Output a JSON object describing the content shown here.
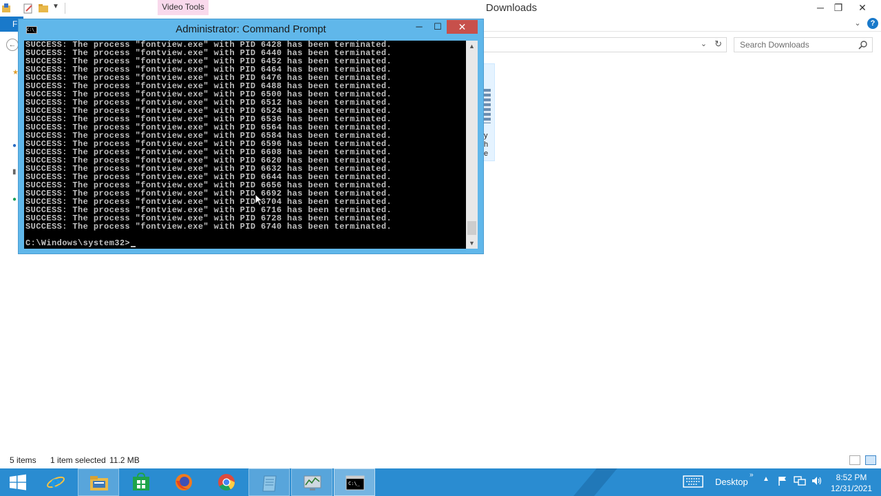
{
  "explorer": {
    "title": "Downloads",
    "contextual_tab": "Video Tools",
    "file_tab": "F",
    "search_placeholder": "Search Downloads",
    "tile_text": [
      "y",
      "h",
      "e"
    ],
    "status": {
      "items": "5 items",
      "selected": "1 item selected",
      "size": "11.2 MB"
    }
  },
  "cmd": {
    "title": "Administrator: Command Prompt",
    "icon_text": "C:\\_",
    "lines": [
      "SUCCESS: The process \"fontview.exe\" with PID 6428 has been terminated.",
      "SUCCESS: The process \"fontview.exe\" with PID 6440 has been terminated.",
      "SUCCESS: The process \"fontview.exe\" with PID 6452 has been terminated.",
      "SUCCESS: The process \"fontview.exe\" with PID 6464 has been terminated.",
      "SUCCESS: The process \"fontview.exe\" with PID 6476 has been terminated.",
      "SUCCESS: The process \"fontview.exe\" with PID 6488 has been terminated.",
      "SUCCESS: The process \"fontview.exe\" with PID 6500 has been terminated.",
      "SUCCESS: The process \"fontview.exe\" with PID 6512 has been terminated.",
      "SUCCESS: The process \"fontview.exe\" with PID 6524 has been terminated.",
      "SUCCESS: The process \"fontview.exe\" with PID 6536 has been terminated.",
      "SUCCESS: The process \"fontview.exe\" with PID 6564 has been terminated.",
      "SUCCESS: The process \"fontview.exe\" with PID 6584 has been terminated.",
      "SUCCESS: The process \"fontview.exe\" with PID 6596 has been terminated.",
      "SUCCESS: The process \"fontview.exe\" with PID 6608 has been terminated.",
      "SUCCESS: The process \"fontview.exe\" with PID 6620 has been terminated.",
      "SUCCESS: The process \"fontview.exe\" with PID 6632 has been terminated.",
      "SUCCESS: The process \"fontview.exe\" with PID 6644 has been terminated.",
      "SUCCESS: The process \"fontview.exe\" with PID 6656 has been terminated.",
      "SUCCESS: The process \"fontview.exe\" with PID 6692 has been terminated.",
      "SUCCESS: The process \"fontview.exe\" with PID 6704 has been terminated.",
      "SUCCESS: The process \"fontview.exe\" with PID 6716 has been terminated.",
      "SUCCESS: The process \"fontview.exe\" with PID 6728 has been terminated.",
      "SUCCESS: The process \"fontview.exe\" with PID 6740 has been terminated."
    ],
    "prompt": "C:\\Windows\\system32>"
  },
  "taskbar": {
    "apps": [
      {
        "name": "internet-explorer",
        "icon": "ie-icon"
      },
      {
        "name": "file-explorer",
        "icon": "folder-icon"
      },
      {
        "name": "store",
        "icon": "store-icon"
      },
      {
        "name": "firefox",
        "icon": "firefox-icon"
      },
      {
        "name": "chrome",
        "icon": "chrome-icon"
      },
      {
        "name": "notepad",
        "icon": "notepad-icon"
      },
      {
        "name": "resource-monitor",
        "icon": "monitor-icon"
      },
      {
        "name": "command-prompt",
        "icon": "cmd-icon"
      }
    ],
    "desktop_label": "Desktop",
    "clock": {
      "time": "8:52 PM",
      "date": "12/31/2021"
    }
  },
  "colors": {
    "taskbar": "#2a8cd1",
    "cmd_frame": "#60b7ea",
    "close_button": "#c7504b",
    "console_bg": "#000000",
    "console_text": "#c0c0c0",
    "file_tab": "#1979ca",
    "contextual_tab": "#f9d9ec"
  }
}
